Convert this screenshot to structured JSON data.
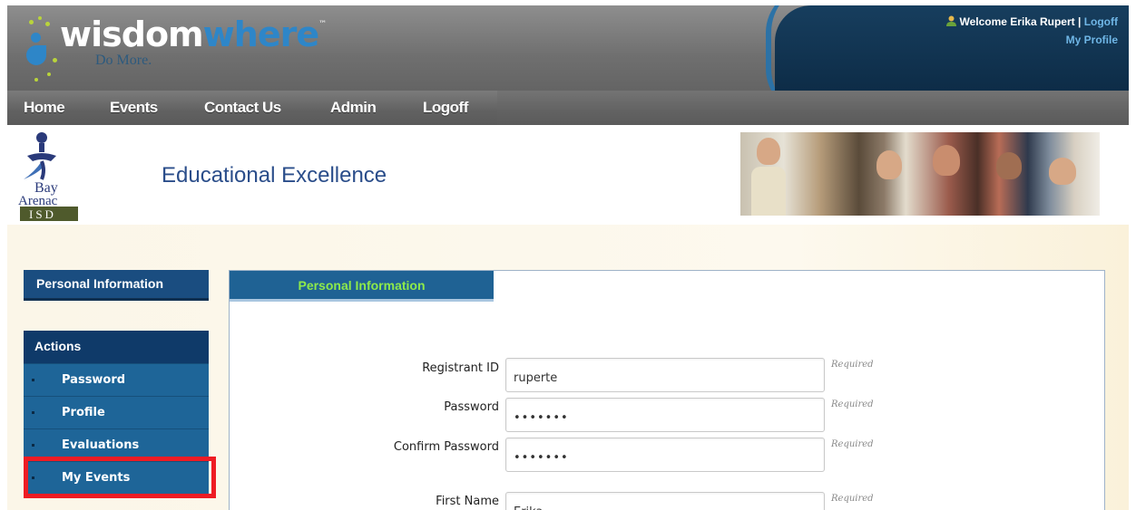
{
  "header": {
    "logo_word_wisdom": "wisdom",
    "logo_word_where": "where",
    "logo_tm": "™",
    "tagline": "Do More.",
    "welcome_text": "Welcome Erika Rupert",
    "separator": "|",
    "logoff_link": "Logoff",
    "profile_link": "My Profile"
  },
  "nav": {
    "items": [
      "Home",
      "Events",
      "Contact Us",
      "Admin",
      "Logoff"
    ]
  },
  "banner": {
    "org_logo_line1": "Bay",
    "org_logo_line2": "Arenac",
    "org_logo_line3": "ISD",
    "title": "Educational Excellence"
  },
  "sidebar": {
    "personal_info_label": "Personal Information",
    "actions_header": "Actions",
    "actions": [
      "Password",
      "Profile",
      "Evaluations",
      "My Events"
    ]
  },
  "panel": {
    "tab_label": "Personal Information",
    "fields": [
      {
        "label": "Registrant ID",
        "value": "ruperte",
        "note": "Required"
      },
      {
        "label": "Password",
        "value": "•••••••",
        "note": "Required"
      },
      {
        "label": "Confirm Password",
        "value": "•••••••",
        "note": "Required"
      },
      {
        "label": "First Name",
        "value": "Erika",
        "note": "Required"
      }
    ]
  },
  "colors": {
    "highlight": "#ee1c24",
    "tab_text": "#8eea4a",
    "link": "#6fb6e6"
  }
}
